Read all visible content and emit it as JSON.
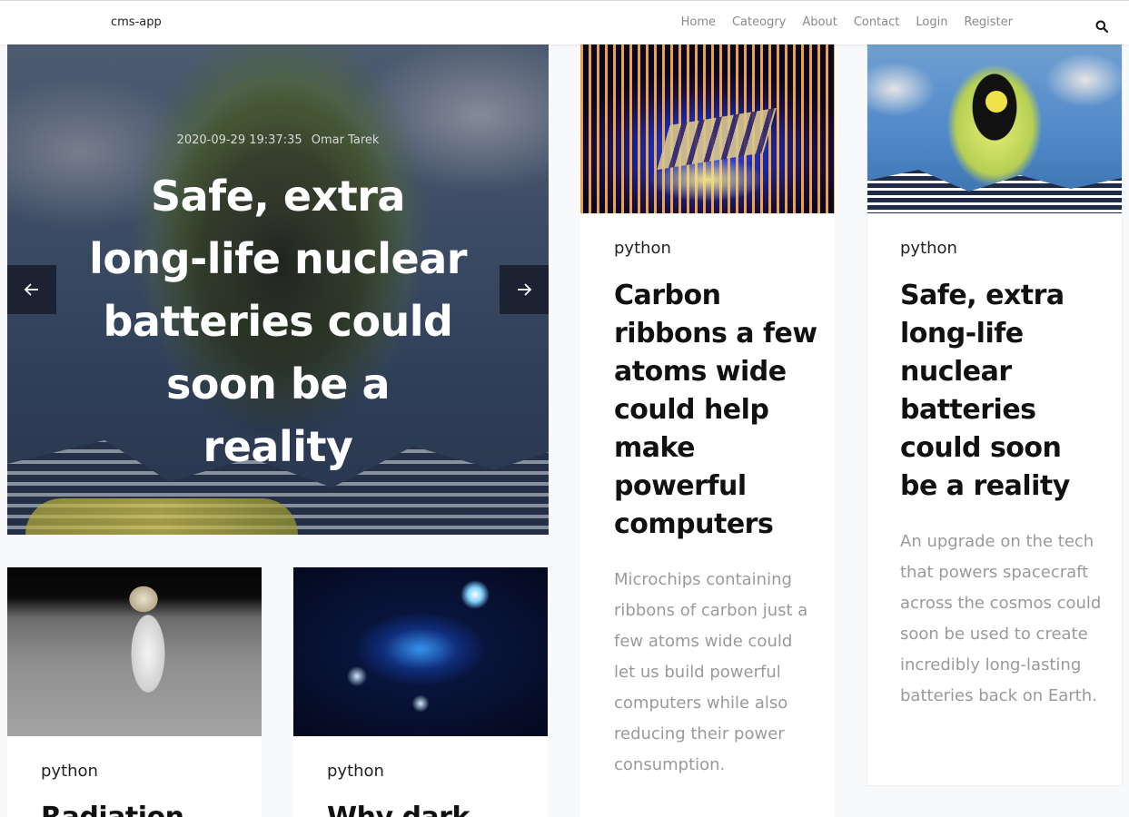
{
  "navbar": {
    "brand": "cms-app",
    "links": [
      "Home",
      "Cateogry",
      "About",
      "Contact",
      "Login",
      "Register"
    ]
  },
  "hero": {
    "date": "2020-09-29 19:37:35",
    "author": "Omar Tarek",
    "title": "Safe, extra long-life nuclear batteries could soon be a reality"
  },
  "posts": [
    {
      "category": "python",
      "title": "Carbon ribbons a few atoms wide could help make powerful computers",
      "excerpt": "Microchips containing ribbons of carbon just a few atoms wide could let us build powerful computers while also reducing their power consumption."
    },
    {
      "category": "python",
      "title": "Safe, extra long-life nuclear batteries could soon be a reality",
      "excerpt": "An upgrade on the tech that powers spacecraft across the cosmos could soon be used to create incredibly long-lasting batteries back on Earth."
    },
    {
      "category": "python",
      "title": "Radiation"
    },
    {
      "category": "python",
      "title": "Why dark"
    }
  ],
  "icons": {
    "search": "search-icon",
    "prev": "arrow-left-icon",
    "next": "arrow-right-icon"
  }
}
